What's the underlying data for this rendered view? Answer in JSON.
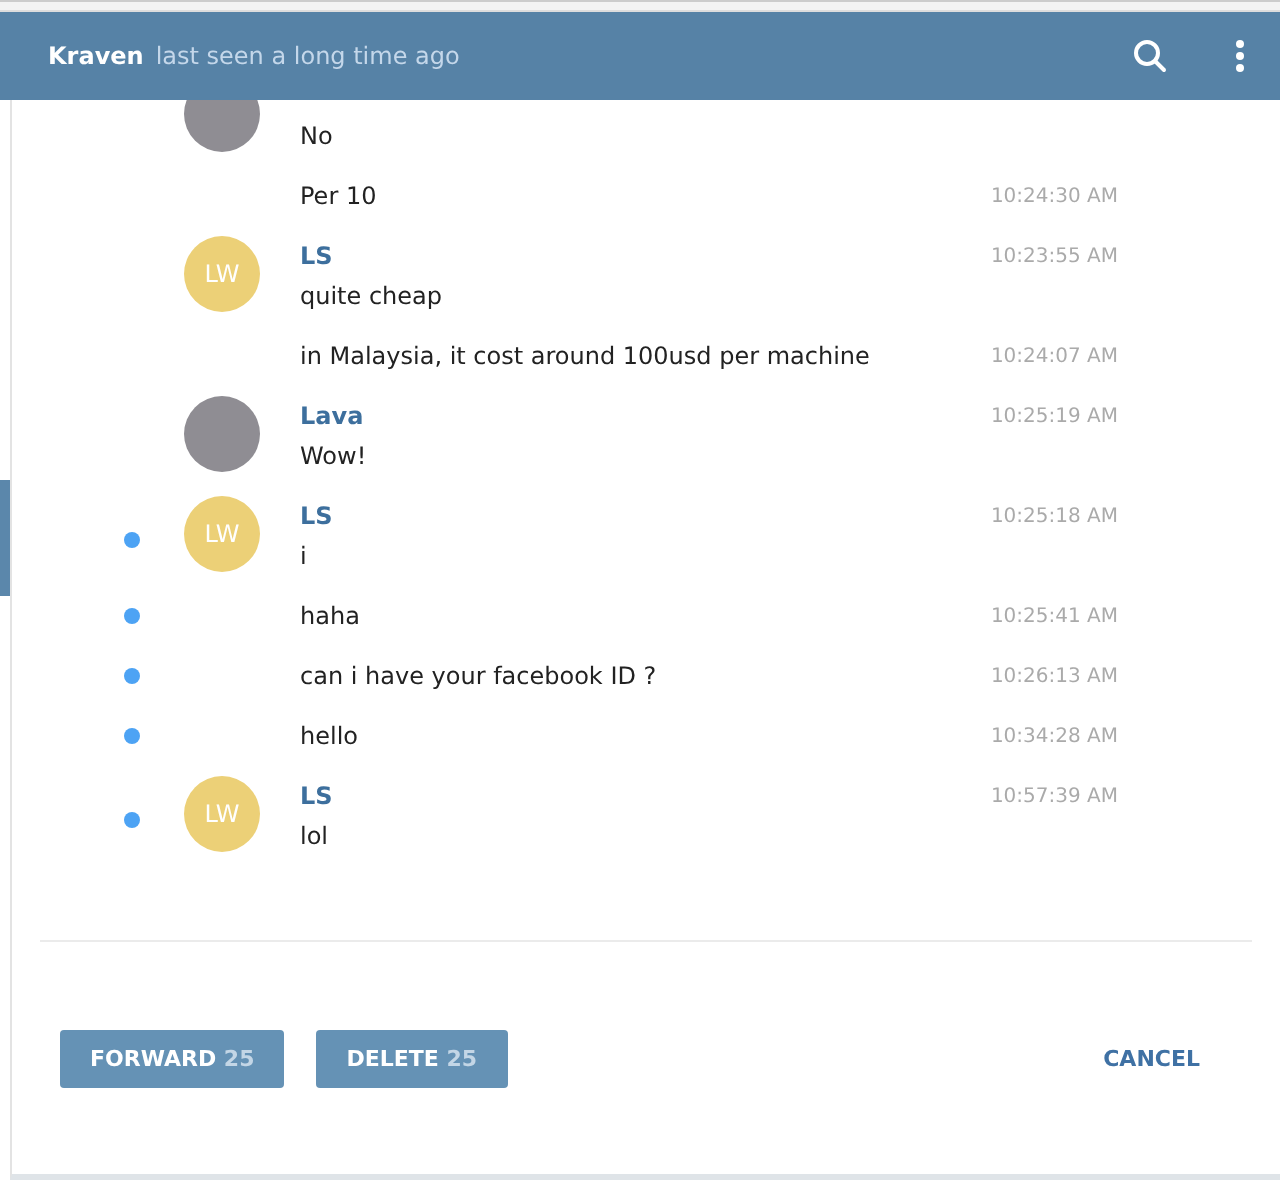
{
  "header": {
    "name": "Kraven",
    "status": "last seen a long time ago"
  },
  "messages": [
    {
      "avatar": {
        "kind": "photo"
      },
      "text": "No",
      "selected": false
    },
    {
      "text": "Per 10",
      "time": "10:24:30 AM",
      "selected": false
    },
    {
      "sender": "LS",
      "avatar": {
        "kind": "initials",
        "initials": "LW",
        "color": "#ecd077"
      },
      "text": "quite cheap",
      "time": "10:23:55 AM",
      "selected": false
    },
    {
      "text": "in Malaysia, it cost around 100usd per machine",
      "time": "10:24:07 AM",
      "selected": false
    },
    {
      "sender": "Lava",
      "avatar": {
        "kind": "photo"
      },
      "text": "Wow!",
      "time": "10:25:19 AM",
      "selected": false
    },
    {
      "sender": "LS",
      "avatar": {
        "kind": "initials",
        "initials": "LW",
        "color": "#ecd077"
      },
      "text": "i",
      "time": "10:25:18 AM",
      "selected": true
    },
    {
      "text": "haha",
      "time": "10:25:41 AM",
      "selected": true
    },
    {
      "text": "can i have your facebook ID ?",
      "time": "10:26:13 AM",
      "selected": true
    },
    {
      "text": "hello",
      "time": "10:34:28 AM",
      "selected": true
    },
    {
      "sender": "LS",
      "avatar": {
        "kind": "initials",
        "initials": "LW",
        "color": "#ecd077"
      },
      "text": "lol",
      "time": "10:57:39 AM",
      "selected": true
    }
  ],
  "actions": [
    {
      "kind": "primary",
      "label": "FORWARD",
      "count": "25"
    },
    {
      "kind": "primary",
      "label": "DELETE",
      "count": "25"
    },
    {
      "kind": "link",
      "label": "CANCEL"
    }
  ]
}
